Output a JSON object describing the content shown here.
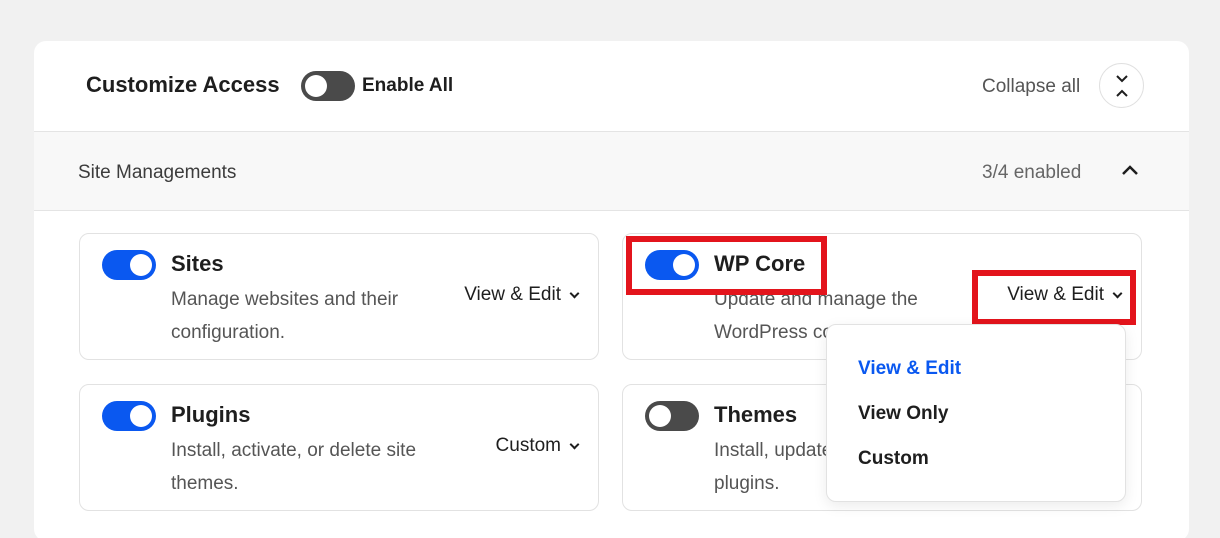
{
  "header": {
    "title": "Customize Access",
    "enable_all_label": "Enable All",
    "enable_all_on": false,
    "collapse_all_label": "Collapse all"
  },
  "section": {
    "title": "Site Managements",
    "count": "3/4 enabled"
  },
  "cards": [
    {
      "title": "Sites",
      "description": "Manage websites and their configuration.",
      "permission": "View & Edit",
      "enabled": true
    },
    {
      "title": "WP Core",
      "description": "Update and manage the WordPress core.",
      "permission": "View & Edit",
      "enabled": true
    },
    {
      "title": "Plugins",
      "description": "Install, activate, or delete site themes.",
      "permission": "Custom",
      "enabled": true
    },
    {
      "title": "Themes",
      "description": "Install, update and manage plugins.",
      "permission": "",
      "enabled": false
    }
  ],
  "dropdown": {
    "options": [
      "View & Edit",
      "View Only",
      "Custom"
    ],
    "selected": "View & Edit"
  },
  "colors": {
    "accent": "#0a58f0",
    "highlight": "#e3141c",
    "toggle_off": "#4a4a4a"
  }
}
